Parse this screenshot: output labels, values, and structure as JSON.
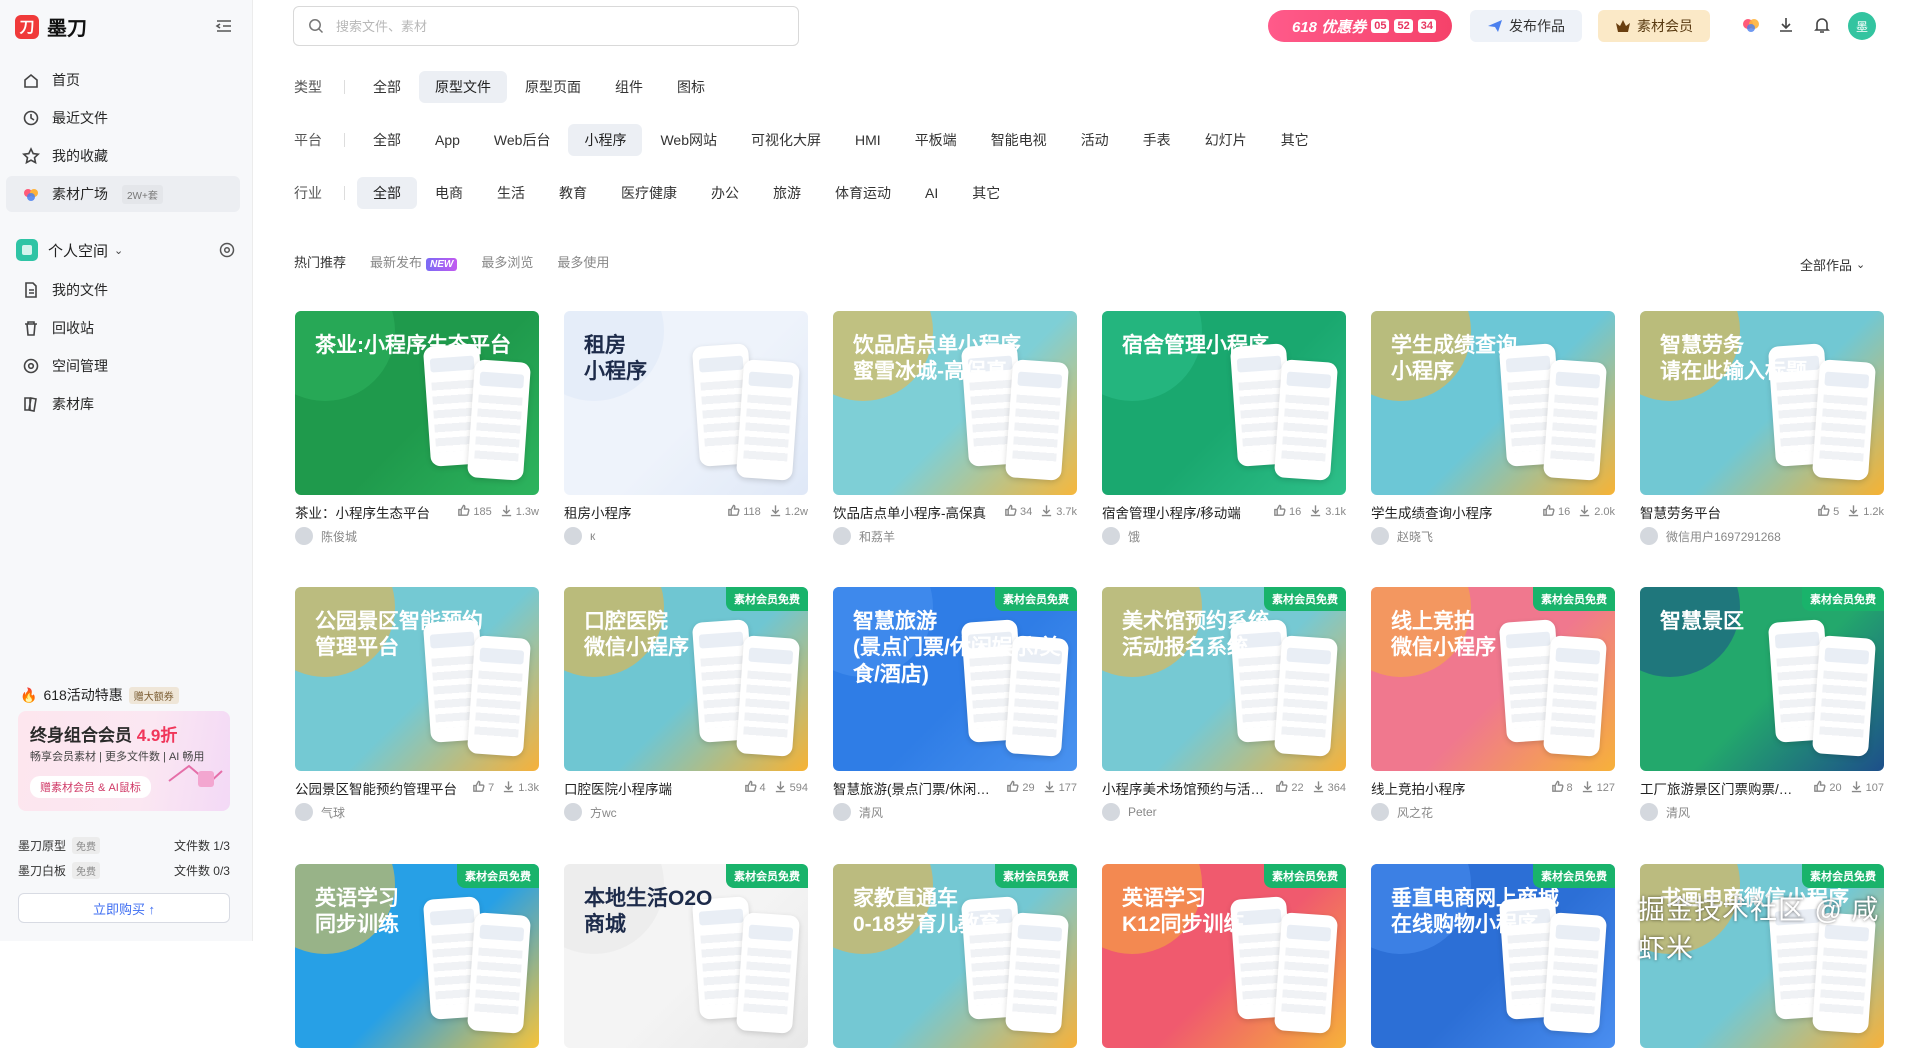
{
  "app": {
    "name": "墨刀"
  },
  "nav": [
    {
      "label": "首页",
      "icon": "home-icon"
    },
    {
      "label": "最近文件",
      "icon": "clock-icon"
    },
    {
      "label": "我的收藏",
      "icon": "star-icon"
    },
    {
      "label": "素材广场",
      "icon": "colorful-petal-icon",
      "badge": "2W+套"
    }
  ],
  "space": {
    "title": "个人空间",
    "items": [
      {
        "label": "我的文件",
        "icon": "file-icon"
      },
      {
        "label": "回收站",
        "icon": "trash-icon"
      },
      {
        "label": "空间管理",
        "icon": "settings-icon"
      },
      {
        "label": "素材库",
        "icon": "library-icon"
      }
    ]
  },
  "promo": {
    "title": "618活动特惠",
    "badge": "赠大额券",
    "line1_prefix": "终身组合会员",
    "line1_highlight": "4.9折",
    "line2": "畅享会员素材 | 更多文件数 | AI 畅用",
    "line3": "赠素材会员 & AI鼠标"
  },
  "quotas": [
    {
      "name": "墨刀原型",
      "tag": "免费",
      "count": "文件数 1/3"
    },
    {
      "name": "墨刀白板",
      "tag": "免费",
      "count": "文件数 0/3"
    }
  ],
  "buy_label": "立即购买 ↑",
  "search": {
    "placeholder": "搜索文件、素材",
    "value": ""
  },
  "coupon": {
    "label": "618 优惠券",
    "h": "05",
    "m": "52",
    "s": "34"
  },
  "publish_label": "发布作品",
  "vip_label": "素材会员",
  "avatar_text": "墨",
  "filters": {
    "type": {
      "label": "类型",
      "options": [
        "全部",
        "原型文件",
        "原型页面",
        "组件",
        "图标"
      ],
      "selected": 1
    },
    "platform": {
      "label": "平台",
      "options": [
        "全部",
        "App",
        "Web后台",
        "小程序",
        "Web网站",
        "可视化大屏",
        "HMI",
        "平板端",
        "智能电视",
        "活动",
        "手表",
        "幻灯片",
        "其它"
      ],
      "selected": 3
    },
    "industry": {
      "label": "行业",
      "options": [
        "全部",
        "电商",
        "生活",
        "教育",
        "医疗健康",
        "办公",
        "旅游",
        "体育运动",
        "AI",
        "其它"
      ],
      "selected": 0
    }
  },
  "sort": {
    "options": [
      "热门推荐",
      "最新发布",
      "最多浏览",
      "最多使用"
    ],
    "new_badge": "NEW",
    "all_works": "全部作品"
  },
  "ribbon_label": "素材会员免费",
  "cards": [
    {
      "name": "茶业：小程序生态平台",
      "likes": "185",
      "downloads": "1.3w",
      "author": "陈俊城",
      "thumb_title": "茶业:小程序生态平台",
      "bg": "#1f9a4c",
      "bg2": "#2db45e",
      "ribbon": false
    },
    {
      "name": "租房小程序",
      "likes": "118",
      "downloads": "1.2w",
      "author": "к",
      "thumb_title": "租房\n小程序",
      "bg": "#eef3fb",
      "bg2": "#dfe8f7",
      "ribbon": false,
      "dark": true
    },
    {
      "name": "饮品店点单小程序-高保真",
      "likes": "34",
      "downloads": "3.7k",
      "author": "和荔羊",
      "thumb_title": "饮品店点单小程序\n蜜雪冰城-高保真",
      "bg": "#7ecfd6",
      "bg2": "#f6b73c",
      "ribbon": false
    },
    {
      "name": "宿舍管理小程序/移动端",
      "likes": "16",
      "downloads": "3.1k",
      "author": "饿",
      "thumb_title": "宿舍管理小程序",
      "bg": "#1aa86f",
      "bg2": "#2ec08a",
      "ribbon": false
    },
    {
      "name": "学生成绩查询小程序",
      "likes": "16",
      "downloads": "2.0k",
      "author": "赵晓飞",
      "thumb_title": "学生成绩查询\n小程序",
      "bg": "#6cc7d6",
      "bg2": "#f7b335",
      "ribbon": false
    },
    {
      "name": "智慧劳务平台",
      "likes": "5",
      "downloads": "1.2k",
      "author": "微信用户1697291268",
      "thumb_title": "智慧劳务\n请在此输入标题",
      "bg": "#71c8d3",
      "bg2": "#f6b233",
      "ribbon": false
    },
    {
      "name": "公园景区智能预约管理平台",
      "likes": "7",
      "downloads": "1.3k",
      "author": "气球",
      "thumb_title": "公园景区智能预约\n管理平台",
      "bg": "#74c9d3",
      "bg2": "#f6b13a",
      "ribbon": false
    },
    {
      "name": "口腔医院小程序端",
      "likes": "4",
      "downloads": "594",
      "author": "方wc",
      "thumb_title": "口腔医院\n微信小程序",
      "bg": "#6fc6d2",
      "bg2": "#f7b233",
      "ribbon": true
    },
    {
      "name": "智慧旅游(景点门票/休闲娱乐/美食/酒店)",
      "likes": "29",
      "downloads": "177",
      "author": "清风",
      "thumb_title": "智慧旅游\n(景点门票/休闲娱乐/美食/酒店)",
      "bg": "#2f7de6",
      "bg2": "#4a93f0",
      "ribbon": true
    },
    {
      "name": "小程序美术场馆预约与活动报名",
      "likes": "22",
      "downloads": "364",
      "author": "Peter",
      "thumb_title": "美术馆预约系统\n活动报名系统",
      "bg": "#76c9d3",
      "bg2": "#f6b23a",
      "ribbon": true
    },
    {
      "name": "线上竞拍小程序",
      "likes": "8",
      "downloads": "127",
      "author": "风之花",
      "thumb_title": "线上竞拍\n微信小程序",
      "bg": "#f0788e",
      "bg2": "#f6b13a",
      "ribbon": true
    },
    {
      "name": "工厂旅游景区门票购票/活动",
      "likes": "20",
      "downloads": "107",
      "author": "清风",
      "thumb_title": "智慧景区",
      "bg": "#23a86c",
      "bg2": "#1d4f8a",
      "ribbon": true
    },
    {
      "name": "",
      "thumb_title": "英语学习\n同步训练",
      "bg": "#27a0e6",
      "bg2": "#f6c33a",
      "ribbon": true
    },
    {
      "name": "",
      "thumb_title": "本地生活O2O\n商城",
      "bg": "#f4f4f4",
      "bg2": "#e8e8e8",
      "ribbon": true,
      "dark": true
    },
    {
      "name": "",
      "thumb_title": "家教直通车\n0-18岁育儿教育",
      "bg": "#74c8d3",
      "bg2": "#f6b13a",
      "ribbon": true
    },
    {
      "name": "",
      "thumb_title": "英语学习\nK12同步训练",
      "bg": "#f05a6e",
      "bg2": "#f6b13a",
      "ribbon": true
    },
    {
      "name": "",
      "thumb_title": "垂直电商网上商城\n在线购物小程序",
      "bg": "#2c6fd6",
      "bg2": "#4a8ef0",
      "ribbon": true
    },
    {
      "name": "",
      "thumb_title": "书画电商微信小程序",
      "bg": "#73c8d3",
      "bg2": "#f6b13a",
      "ribbon": true
    }
  ],
  "watermark": "掘金技术社区 @ 咸虾米"
}
